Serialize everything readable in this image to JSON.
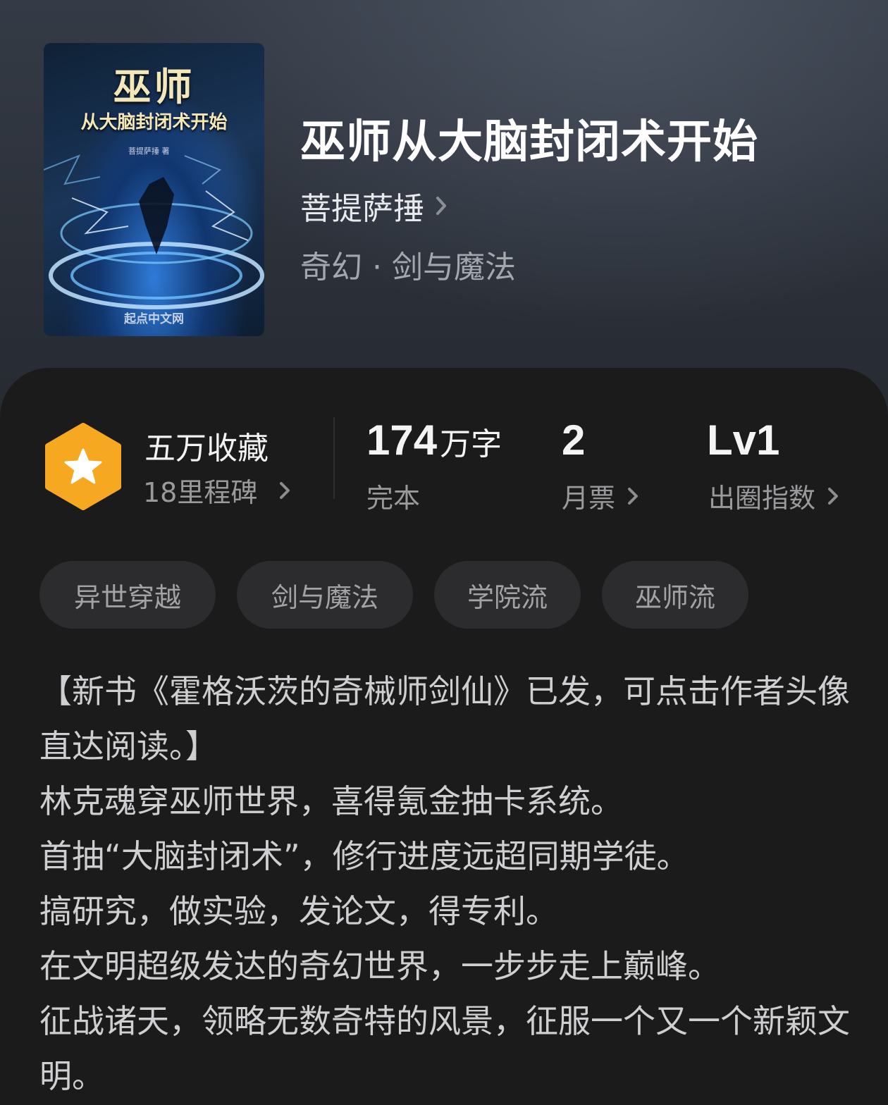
{
  "cover": {
    "title": "巫师",
    "subtitle": "从大脑封闭术开始",
    "author": "菩提萨捶 著",
    "publisher": "起点中文网"
  },
  "book": {
    "title": "巫师从大脑封闭术开始",
    "author": "菩提萨捶",
    "genre": "奇幻 · 剑与魔法"
  },
  "stats": {
    "favorites": "五万收藏",
    "milestones": "18里程碑",
    "word_count": "174",
    "word_unit": "万字",
    "status": "完本",
    "monthly_tickets": "2",
    "monthly_tickets_label": "月票",
    "level": "Lv1",
    "level_label": "出圈指数"
  },
  "tags": [
    "异世穿越",
    "剑与魔法",
    "学院流",
    "巫师流"
  ],
  "synopsis": [
    "【新书《霍格沃茨的奇械师剑仙》已发，可点击作者头像直达阅读。】",
    "林克魂穿巫师世界，喜得氪金抽卡系统。",
    "首抽“大脑封闭术”，修行进度远超同期学徒。",
    "搞研究，做实验，发论文，得专利。",
    "在文明超级发达的奇幻世界，一步步走上巅峰。",
    "征战诸天，领略无数奇特的风景，征服一个又一个新颖文明。"
  ],
  "colors": {
    "badge": "#f7a821",
    "panel_bg": "#1b1b1c",
    "tag_bg": "#2c2c2e"
  }
}
